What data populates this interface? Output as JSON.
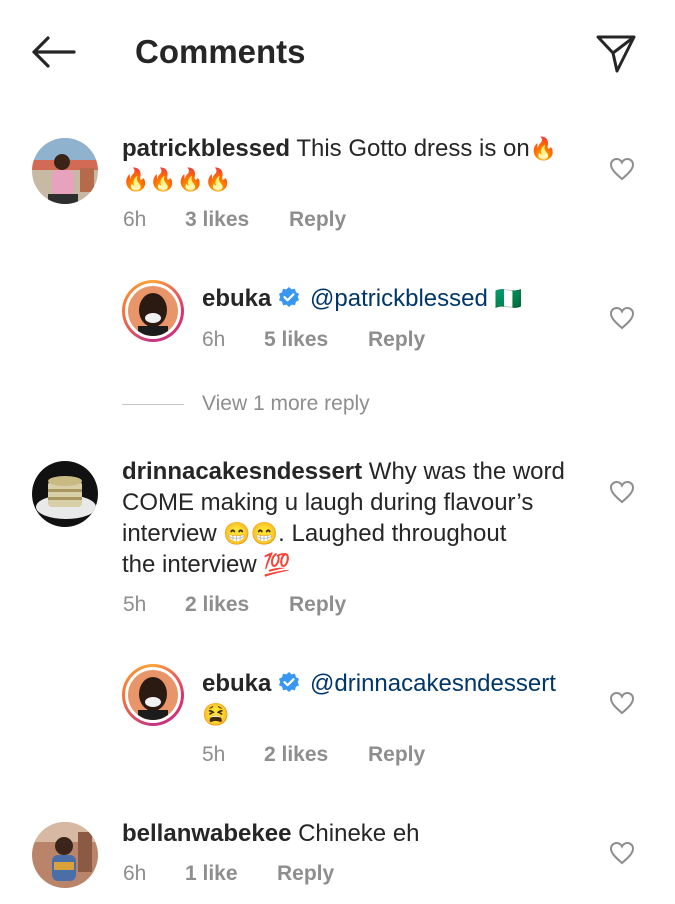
{
  "header": {
    "title": "Comments"
  },
  "comments": [
    {
      "username": "patrickblessed",
      "text": "This Gotto dress is on",
      "emoji_inline": "🔥",
      "emoji_line2": "🔥🔥🔥🔥",
      "time": "6h",
      "likes": "3 likes",
      "reply": "Reply"
    },
    {
      "username": "drinnacakesndessert",
      "text_l1": "Why was the word",
      "text_l2": "COME making u laugh during flavour’s",
      "text_l3a": "interview",
      "text_l3_emoji": "😁😁",
      "text_l3b": ". Laughed throughout",
      "text_l4": "the interview",
      "text_l4_emoji": "💯",
      "time": "5h",
      "likes": "2 likes",
      "reply": "Reply"
    },
    {
      "username": "bellanwabekee",
      "text": "Chineke eh",
      "time": "6h",
      "likes": "1 like",
      "reply": "Reply"
    }
  ],
  "replies": [
    {
      "username": "ebuka",
      "mention": "@patrickblessed",
      "emoji": "🇳🇬",
      "time": "6h",
      "likes": "5 likes",
      "reply": "Reply"
    },
    {
      "username": "ebuka",
      "mention": "@drinnacakesndessert",
      "emoji": "😫",
      "time": "5h",
      "likes": "2 likes",
      "reply": "Reply"
    }
  ],
  "view_more": "View 1 more reply",
  "icons": {
    "back": "arrow-left-icon",
    "share": "paper-plane-icon",
    "like": "heart-outline-icon",
    "verified": "verified-badge-icon"
  },
  "colors": {
    "text": "#262626",
    "secondary": "#8e8e8e",
    "mention": "#00376b",
    "verified": "#3897f0"
  }
}
